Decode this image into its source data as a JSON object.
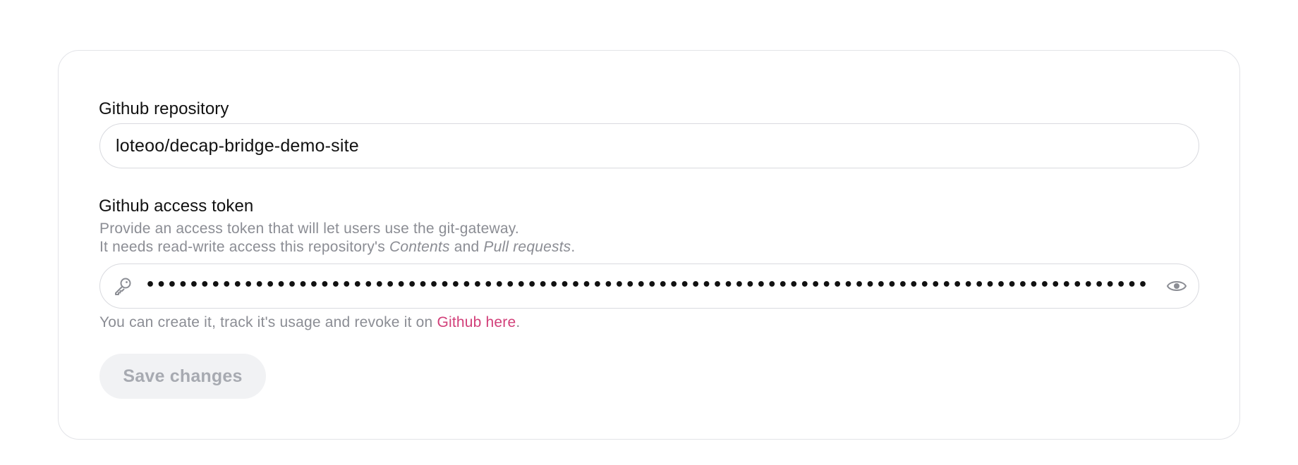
{
  "repository": {
    "label": "Github repository",
    "value": "loteoo/decap-bridge-demo-site"
  },
  "token": {
    "label": "Github access token",
    "help_line_1": "Provide an access token that will let users use the git-gateway.",
    "help_line_2_prefix": "It needs read-write access this repository's ",
    "help_line_2_contents": "Contents",
    "help_line_2_and": " and ",
    "help_line_2_pull": "Pull requests",
    "help_line_2_suffix": ".",
    "masked_value": "••••••••••••••••••••••••••••••••••••••••••••••••••••••••••••••••••••••••••••••••••••••••••••",
    "leading_icon": "key-icon",
    "trailing_icon": "eye-icon",
    "footer_prefix": "You can create it, track it's usage and revoke it on ",
    "footer_link": "Github here",
    "footer_suffix": "."
  },
  "actions": {
    "save_label": "Save changes"
  },
  "colors": {
    "link": "#d2407a",
    "muted_text": "#8b8d94",
    "border": "#d9dadf",
    "button_disabled_bg": "#f1f2f4",
    "button_disabled_text": "#a7aab1"
  }
}
